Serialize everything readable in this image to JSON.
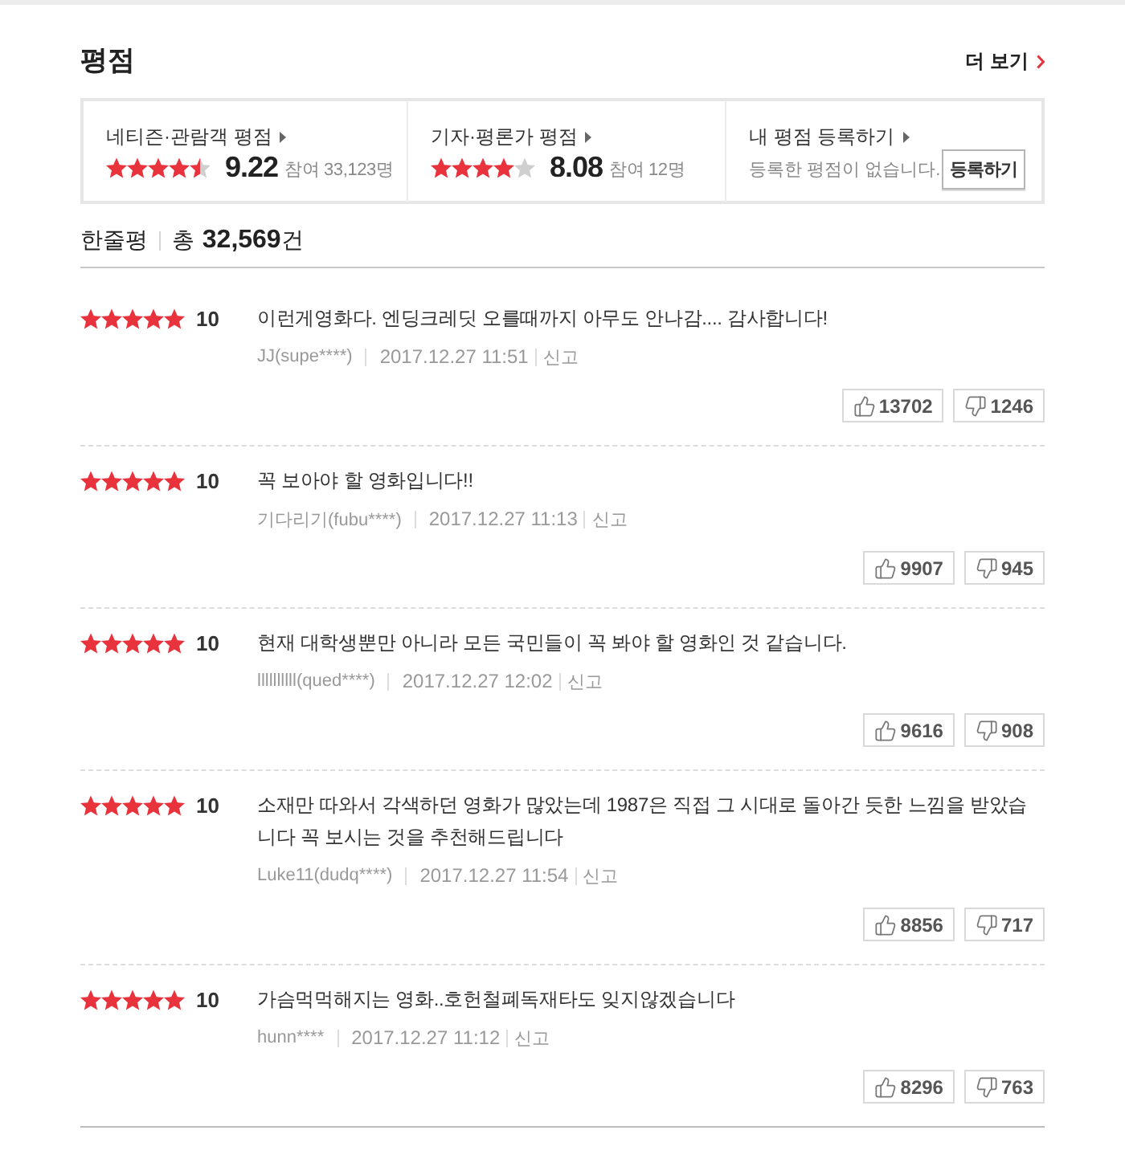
{
  "section": {
    "title": "평점",
    "more_link": "더 보기"
  },
  "summary": [
    {
      "kind": "score",
      "label": "네티즌·관람객 평점",
      "stars": 4.5,
      "score": "9.22",
      "participants": "참여 33,123명"
    },
    {
      "kind": "score",
      "label": "기자·평론가 평점",
      "stars": 4,
      "score": "8.08",
      "participants": "참여 12명"
    },
    {
      "kind": "register",
      "label": "내 평점 등록하기",
      "message": "등록한 평점이 없습니다.",
      "button": "등록하기"
    }
  ],
  "reviews_header": {
    "label": "한줄평",
    "total": "총 **32,569**건"
  },
  "reviews": [
    {
      "stars": 5,
      "score": "10",
      "text": "이런게영화다. 엔딩크레딧 오를때까지 아무도 안나감.... 감사합니다!",
      "author": "JJ(supe****)",
      "date": "2017.12.27 11:51",
      "report": "신고",
      "likes": "13702",
      "dislikes": "1246"
    },
    {
      "stars": 5,
      "score": "10",
      "text": "꼭 보아야 할 영화입니다!!",
      "author": "기다리기(fubu****)",
      "date": "2017.12.27 11:13",
      "report": "신고",
      "likes": "9907",
      "dislikes": "945"
    },
    {
      "stars": 5,
      "score": "10",
      "text": "현재 대학생뿐만 아니라 모든 국민들이 꼭 봐야 할 영화인 것 같습니다.",
      "author": "llllllllll(qued****)",
      "date": "2017.12.27 12:02",
      "report": "신고",
      "likes": "9616",
      "dislikes": "908"
    },
    {
      "stars": 5,
      "score": "10",
      "text": "소재만 따와서 각색하던 영화가 많았는데 1987은 직접 그 시대로 돌아간 듯한 느낌을 받았습니다 꼭 보시는 것을 추천해드립니다",
      "author": "Luke11(dudq****)",
      "date": "2017.12.27 11:54",
      "report": "신고",
      "likes": "8856",
      "dislikes": "717"
    },
    {
      "stars": 5,
      "score": "10",
      "text": "가슴먹먹해지는 영화..호헌철폐독재타도 잊지않겠습니다",
      "author": "hunn****",
      "date": "2017.12.27 11:12",
      "report": "신고",
      "likes": "8296",
      "dislikes": "763"
    }
  ]
}
